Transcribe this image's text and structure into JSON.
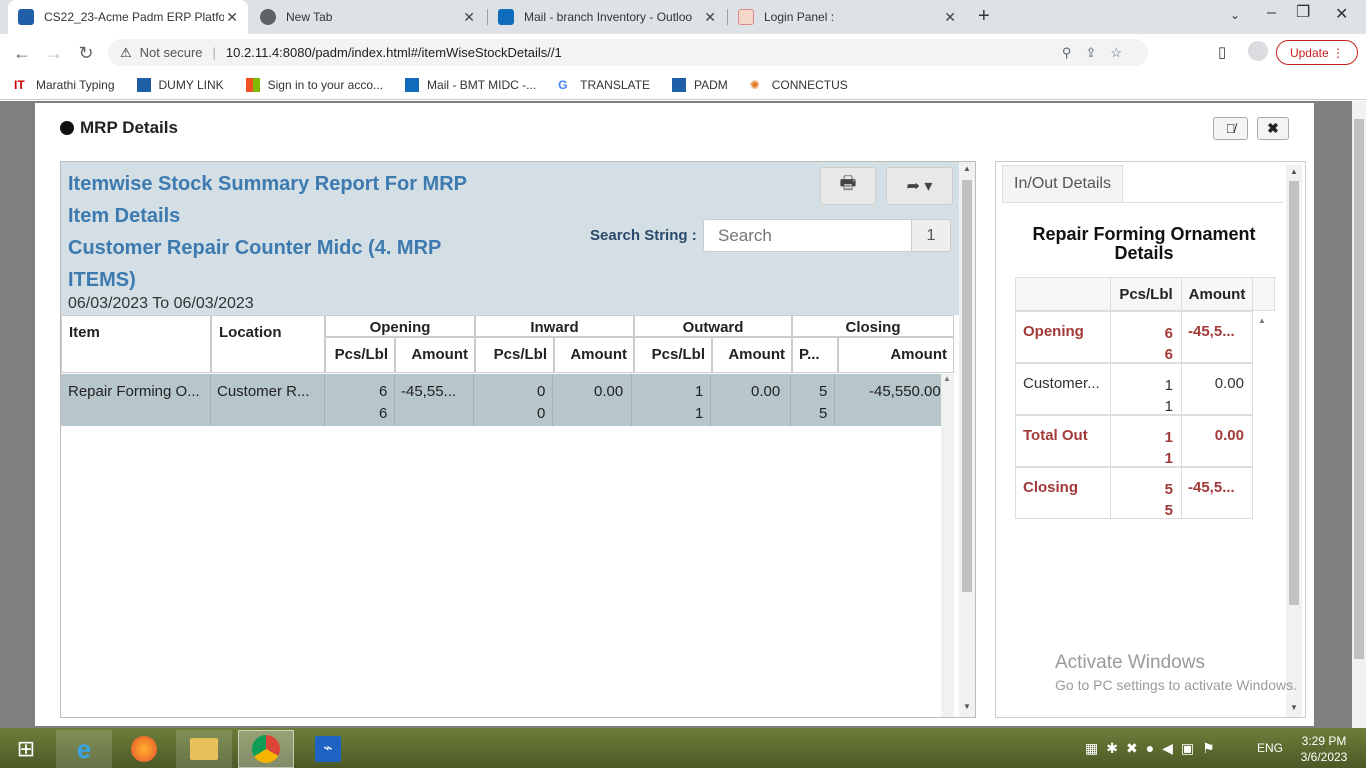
{
  "browser": {
    "tabs": [
      {
        "title": "CS22_23-Acme Padm ERP Platfor",
        "active": true
      },
      {
        "title": "New Tab",
        "active": false
      },
      {
        "title": "Mail - branch Inventory - Outloo",
        "active": false
      },
      {
        "title": "Login Panel :",
        "active": false
      }
    ],
    "security": "Not secure",
    "url": "10.2.11.4:8080/padm/index.html#/itemWiseStockDetails//1",
    "update_label": "Update",
    "bookmarks": [
      "Marathi Typing",
      "DUMY LINK",
      "Sign in to your acco...",
      "Mail - BMT MIDC -...",
      "TRANSLATE",
      "PADM",
      "CONNECTUS"
    ]
  },
  "modal": {
    "title": "MRP Details",
    "report": {
      "title": "Itemwise Stock Summary Report For MRP",
      "subtitle": "Item Details",
      "counter_line1": "Customer Repair Counter Midc (4. MRP",
      "counter_line2": "ITEMS)",
      "date_range": "06/03/2023 To 06/03/2023",
      "search_label": "Search String :",
      "search_placeholder": "Search",
      "page_number": "1",
      "columns": {
        "item": "Item",
        "location": "Location",
        "groups": [
          "Opening",
          "Inward",
          "Outward",
          "Closing"
        ],
        "pcs": "Pcs/Lbl",
        "amount": "Amount",
        "pcs_short": "P..."
      },
      "rows": [
        {
          "item": "Repair Forming O...",
          "location": "Customer R...",
          "opening_pcs_1": "6",
          "opening_pcs_2": "6",
          "opening_amount": "-45,55...",
          "inward_pcs_1": "0",
          "inward_pcs_2": "0",
          "inward_amount": "0.00",
          "outward_pcs_1": "1",
          "outward_pcs_2": "1",
          "outward_amount": "0.00",
          "closing_pcs_1": "5",
          "closing_pcs_2": "5",
          "closing_amount": "-45,550.00"
        }
      ]
    },
    "inout": {
      "tab_label": "In/Out Details",
      "heading": "Repair Forming Ornament Details",
      "col_pcs": "Pcs/Lbl",
      "col_amount": "Amount",
      "rows": [
        {
          "label": "Opening",
          "pcs_1": "6",
          "pcs_2": "6",
          "amount": "-45,5...",
          "highlight": true
        },
        {
          "label": "Customer...",
          "pcs_1": "1",
          "pcs_2": "1",
          "amount": "0.00",
          "highlight": false
        },
        {
          "label": "Total Out",
          "pcs_1": "1",
          "pcs_2": "1",
          "amount": "0.00",
          "highlight": true
        },
        {
          "label": "Closing",
          "pcs_1": "5",
          "pcs_2": "5",
          "amount": "-45,5...",
          "highlight": true
        }
      ]
    }
  },
  "watermark": {
    "line1": "Activate Windows",
    "line2": "Go to PC settings to activate Windows."
  },
  "taskbar": {
    "lang": "ENG",
    "time": "3:29 PM",
    "date": "3/6/2023"
  },
  "colors": {
    "accent_blue": "#3c7ab0",
    "highlight_red": "#a33a3a",
    "report_header": "#d4dfe5",
    "selected_row": "#b6c6cb"
  }
}
